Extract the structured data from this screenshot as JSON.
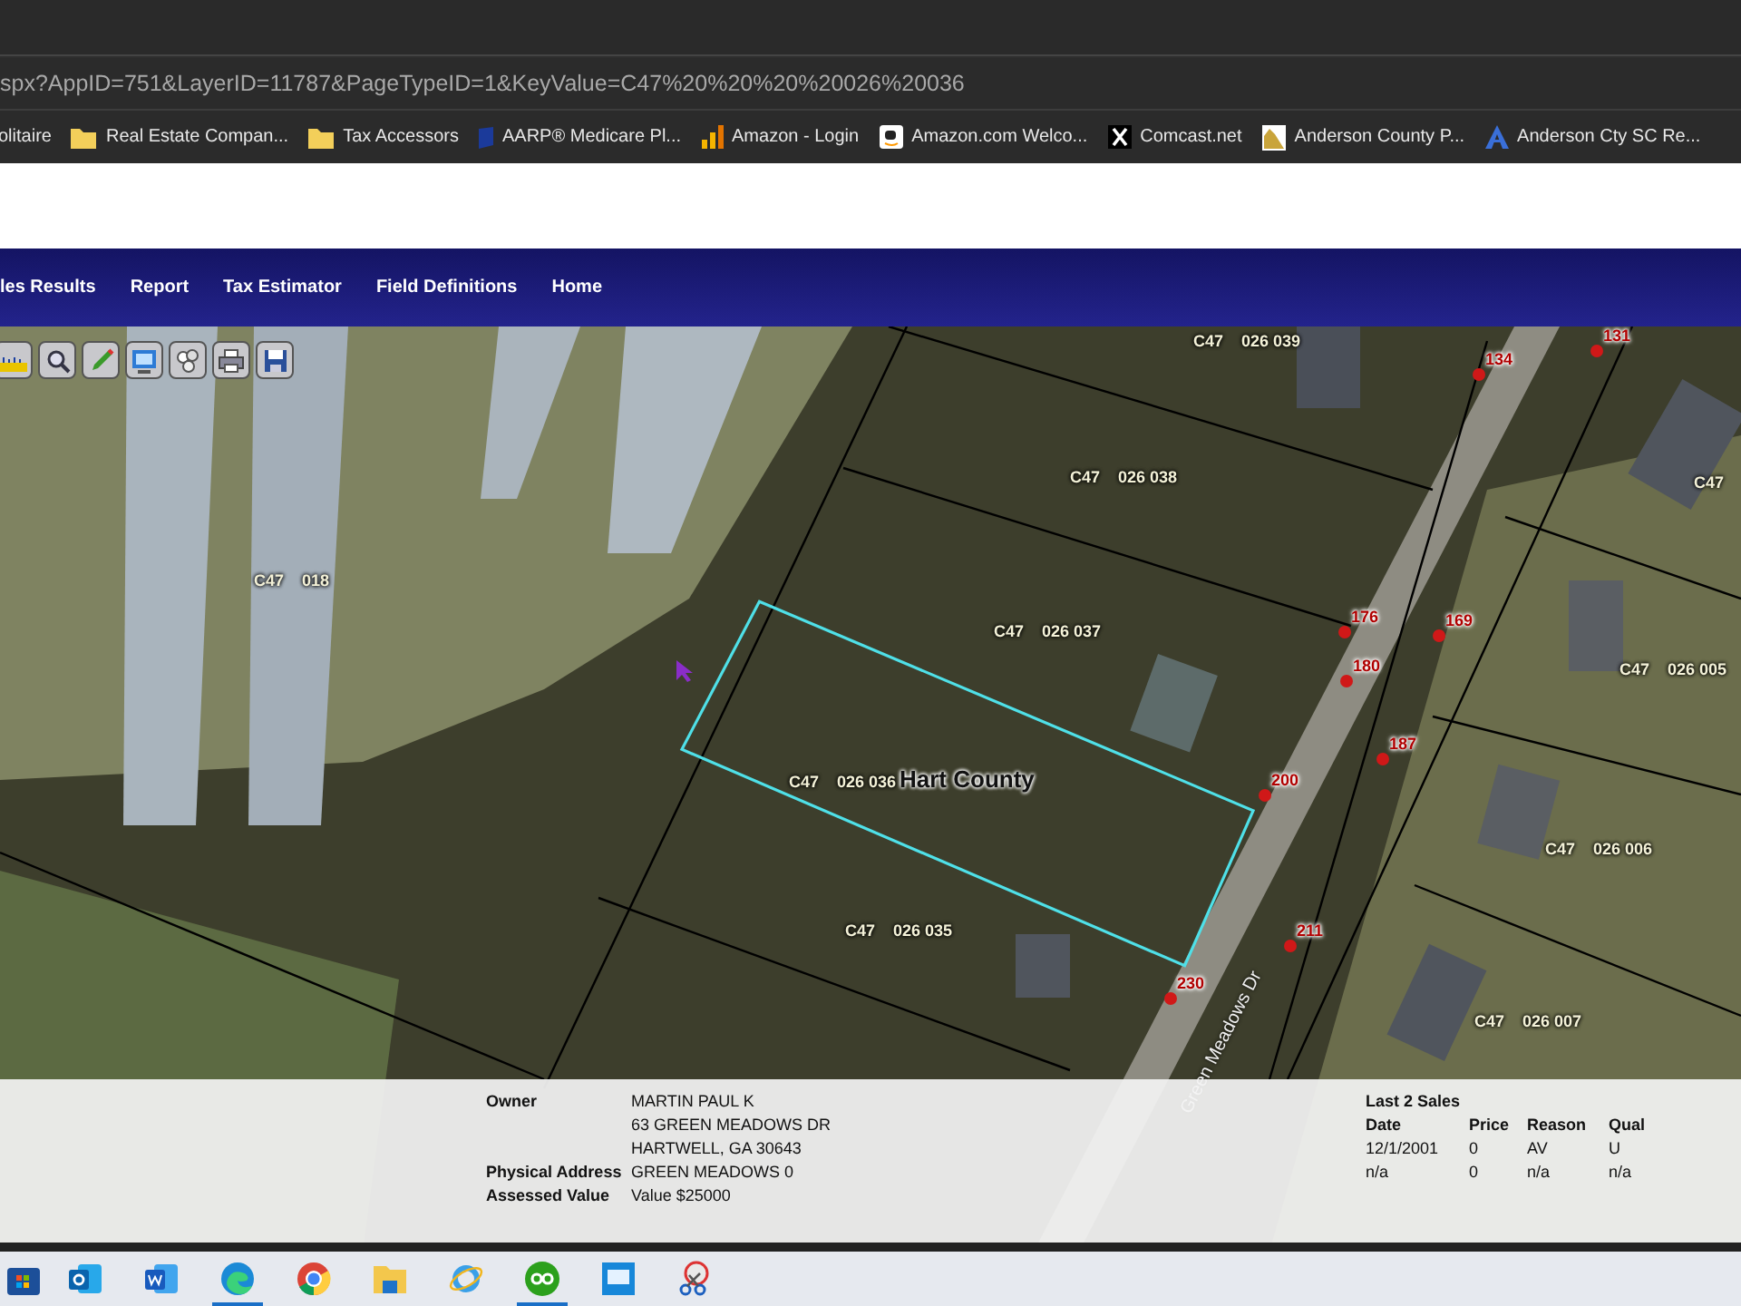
{
  "address_bar": {
    "url": "spx?AppID=751&LayerID=11787&PageTypeID=1&KeyValue=C47%20%20%20%20026%20036"
  },
  "bookmarks": [
    {
      "label": "olitaire",
      "kind": "none"
    },
    {
      "label": "Real Estate Compan...",
      "kind": "folder"
    },
    {
      "label": "Tax Accessors",
      "kind": "folder"
    },
    {
      "label": "AARP® Medicare Pl...",
      "kind": "shield"
    },
    {
      "label": "Amazon - Login",
      "kind": "bars"
    },
    {
      "label": "Amazon.com Welco...",
      "kind": "smile"
    },
    {
      "label": "Comcast.net",
      "kind": "cross"
    },
    {
      "label": "Anderson County P...",
      "kind": "photo"
    },
    {
      "label": "Anderson Cty SC Re...",
      "kind": "triangle"
    }
  ],
  "nav": {
    "items": [
      {
        "label": "les Results"
      },
      {
        "label": "Report"
      },
      {
        "label": "Tax Estimator"
      },
      {
        "label": "Field Definitions"
      },
      {
        "label": "Home"
      }
    ]
  },
  "map": {
    "tools": [
      {
        "kind": "measure"
      },
      {
        "kind": "zoom"
      },
      {
        "kind": "draw"
      },
      {
        "kind": "select"
      },
      {
        "kind": "layers"
      },
      {
        "kind": "print"
      },
      {
        "kind": "save"
      }
    ],
    "parcel_labels": [
      "C47    026 039",
      "C47    026 038",
      "C47    026 037",
      "C47    026 036",
      "C47    026 035",
      "C47    018",
      "C47    026 005",
      "C47    026 006",
      "C47    026 007",
      "C47"
    ],
    "county_label": "Hart County",
    "road_label": "Green Meadows Dr",
    "address_points": [
      "131",
      "134",
      "176",
      "169",
      "180",
      "187",
      "200",
      "211",
      "230"
    ]
  },
  "parcel_info": {
    "fields": [
      {
        "label": "Owner",
        "lines": [
          "MARTIN PAUL K",
          "63 GREEN MEADOWS DR",
          "HARTWELL, GA 30643"
        ]
      },
      {
        "label": "Physical Address",
        "lines": [
          "GREEN MEADOWS 0"
        ]
      },
      {
        "label": "Assessed Value",
        "lines": [
          "Value $25000"
        ]
      }
    ],
    "sales": {
      "title": "Last 2 Sales",
      "columns": [
        "Date",
        "Price",
        "Reason",
        "Qual"
      ],
      "rows": [
        [
          "12/1/2001",
          "0",
          "AV",
          "U"
        ],
        [
          "n/a",
          "0",
          "n/a",
          "n/a"
        ]
      ]
    }
  },
  "taskbar": [
    {
      "kind": "store",
      "running": false
    },
    {
      "kind": "mail",
      "running": false
    },
    {
      "kind": "document",
      "running": false
    },
    {
      "kind": "wave",
      "running": true
    },
    {
      "kind": "ring",
      "running": false
    },
    {
      "kind": "folder",
      "running": false
    },
    {
      "kind": "orbit",
      "running": false
    },
    {
      "kind": "circle",
      "running": true
    },
    {
      "kind": "monitor",
      "running": false
    },
    {
      "kind": "scissors",
      "running": false
    }
  ]
}
